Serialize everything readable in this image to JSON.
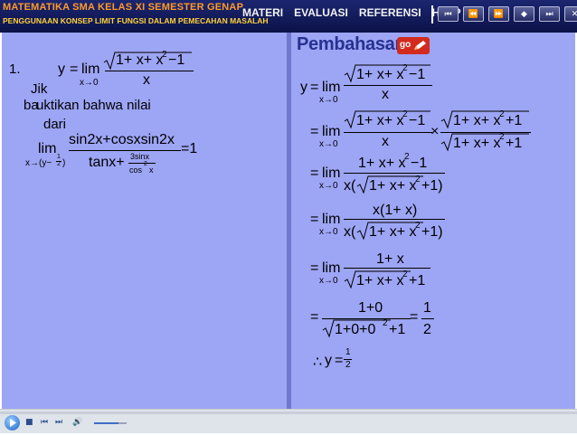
{
  "header": {
    "course_title": "MATEMATIKA SMA KELAS XI SEMESTER GENAP",
    "course_subtitle": "PENGGUNAAN KONSEP LIMIT FUNGSI DALAM PEMECAHAN MASALAH",
    "menu": [
      "MATERI",
      "EVALUASI",
      "REFERENSI",
      "HELP"
    ],
    "nav_buttons": [
      {
        "name": "first-page-icon",
        "glyph": "⏮"
      },
      {
        "name": "rewind-icon",
        "glyph": "⏪"
      },
      {
        "name": "forward-icon",
        "glyph": "⏩"
      },
      {
        "name": "prev-next-icon",
        "glyph": "◆"
      },
      {
        "name": "last-page-icon",
        "glyph": "⏭"
      },
      {
        "name": "close-icon",
        "glyph": "✕"
      }
    ]
  },
  "left": {
    "problem_number": "1.",
    "expr1": {
      "y": "y",
      "eq": "=",
      "lim": "lim",
      "sub": "x→0",
      "num": "1+ x+ x",
      "sup": "2",
      "numtail": " −1",
      "den": "x"
    },
    "text_line1": "Jik",
    "text_line2a": "ba",
    "text_line2b": "uktikan bahwa nilai",
    "text_line3": "dari",
    "expr2": {
      "lim": "lim",
      "sub": "x→(y−",
      "subfrac_n": "1",
      "subfrac_d": "2",
      "subclose": ")",
      "num": "sin2x+cosxsin2x",
      "den_a": "tanx+",
      "den_frac_n": "3sinx",
      "den_frac_d": "cos",
      "den_frac_sup": "2",
      "den_frac_tail": "x",
      "rhs": "=1"
    }
  },
  "right": {
    "title": "Pembahasan",
    "go_label": "go",
    "y": "y",
    "eq": "=",
    "lim": "lim",
    "sub": "x→0",
    "s1": {
      "num": "1+ x+ x",
      "sup": "2",
      "tail": " −1",
      "den": "x"
    },
    "s2": {
      "n1": "1+ x+ x",
      "sup1": "2",
      "tail1": " −1",
      "d1": "x",
      "times": "×",
      "n2": "1+ x+ x",
      "sup2": "2",
      "tail2": " +1",
      "d2": "1+ x+ x",
      "sup3": "2",
      "tail3": " +1"
    },
    "s3": {
      "num": "1+ x+ x",
      "sup": "2",
      "tail": " −1",
      "den_a": "x(",
      "den_b": "1+ x+ x",
      "den_sup": "2",
      "den_c": " +1)"
    },
    "s4": {
      "num": "x(1+ x)",
      "den_a": "x(",
      "den_b": "1+ x+ x",
      "den_sup": "2",
      "den_c": " +1)"
    },
    "s5": {
      "num": "1+ x",
      "den_a": "1+ x+ x",
      "den_sup": "2",
      "den_c": " +1"
    },
    "s6": {
      "num": "1+0",
      "den_a": "1+0+0",
      "den_sup": "2",
      "den_c": " +1",
      "eq2": "=",
      "half_n": "1",
      "half_d": "2"
    },
    "concl": {
      "therefore": "∴",
      "y": "y",
      "eq": "=",
      "n": "1",
      "d": "2"
    }
  },
  "player": {
    "progress": 0.0,
    "volume": 0.75,
    "controls": [
      "stop-icon",
      "skip-back-icon",
      "skip-forward-icon",
      "volume-icon"
    ]
  }
}
